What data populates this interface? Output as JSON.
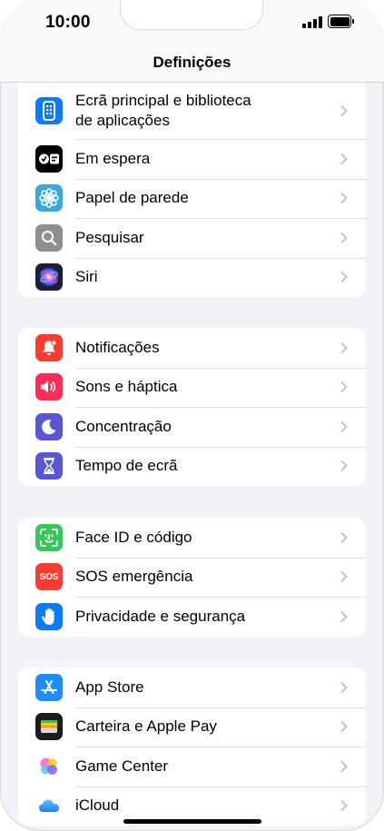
{
  "status": {
    "time": "10:00"
  },
  "nav": {
    "title": "Definições"
  },
  "groups": [
    {
      "items": [
        {
          "label_line1": "Ecrã principal e biblioteca",
          "label_line2": "de aplicações",
          "icon": "home-screen-icon",
          "color": "#0a7aff"
        },
        {
          "label": "Em espera",
          "icon": "standby-icon",
          "color": "#000000"
        },
        {
          "label": "Papel de parede",
          "icon": "wallpaper-flower-icon",
          "color": "#34aadc"
        },
        {
          "label": "Pesquisar",
          "icon": "search-icon",
          "color": "#8e8e93"
        },
        {
          "label": "Siri",
          "icon": "siri-icon",
          "color": "#1c1c3c"
        }
      ]
    },
    {
      "items": [
        {
          "label": "Notificações",
          "icon": "bell-icon",
          "color": "#ff3b30"
        },
        {
          "label": "Sons e háptica",
          "icon": "speaker-icon",
          "color": "#ff2d55"
        },
        {
          "label": "Concentração",
          "icon": "moon-icon",
          "color": "#5856d6"
        },
        {
          "label": "Tempo de ecrã",
          "icon": "hourglass-icon",
          "color": "#5856d6"
        }
      ]
    },
    {
      "items": [
        {
          "label": "Face ID e código",
          "icon": "face-id-icon",
          "color": "#34c759"
        },
        {
          "label": "SOS emergência",
          "icon": "sos-icon",
          "color": "#ff3b30",
          "badge": "SOS"
        },
        {
          "label": "Privacidade e segurança",
          "icon": "hand-icon",
          "color": "#0a7aff"
        }
      ]
    },
    {
      "items": [
        {
          "label": "App Store",
          "icon": "app-store-icon",
          "color": "#1e8cff"
        },
        {
          "label": "Carteira e Apple Pay",
          "icon": "wallet-icon",
          "color": "#1c1c1e"
        },
        {
          "label": "Game Center",
          "icon": "game-center-icon",
          "color": "#ffffff"
        },
        {
          "label": "iCloud",
          "icon": "icloud-icon",
          "color": "#ffffff"
        }
      ]
    }
  ]
}
